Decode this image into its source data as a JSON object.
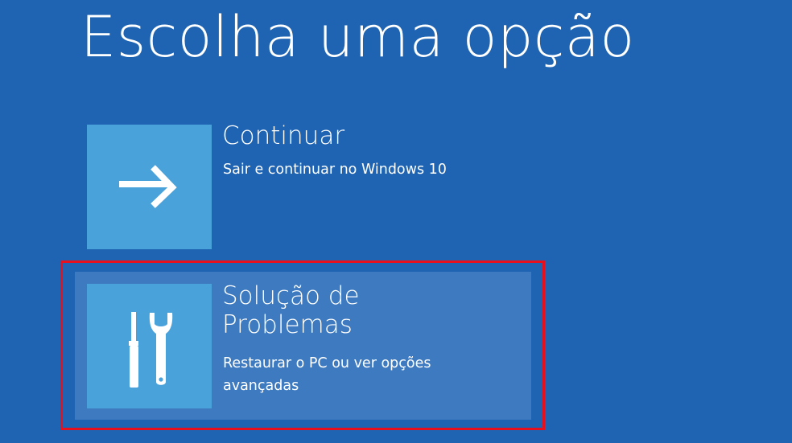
{
  "screen": {
    "title": "Escolha uma opção",
    "background_color": "#1f64b2",
    "tile_color": "#4aa2db",
    "highlight_color": "#e8101c"
  },
  "options": [
    {
      "title_lines": [
        "Continuar"
      ],
      "description_lines": [
        "Sair e continuar no Windows 10"
      ],
      "icon": "arrow-right-icon",
      "selected": false
    },
    {
      "title_lines": [
        "Solução de",
        "Problemas"
      ],
      "description_lines": [
        "Restaurar o PC ou ver opções",
        "avançadas"
      ],
      "icon": "tools-icon",
      "selected": true
    }
  ]
}
